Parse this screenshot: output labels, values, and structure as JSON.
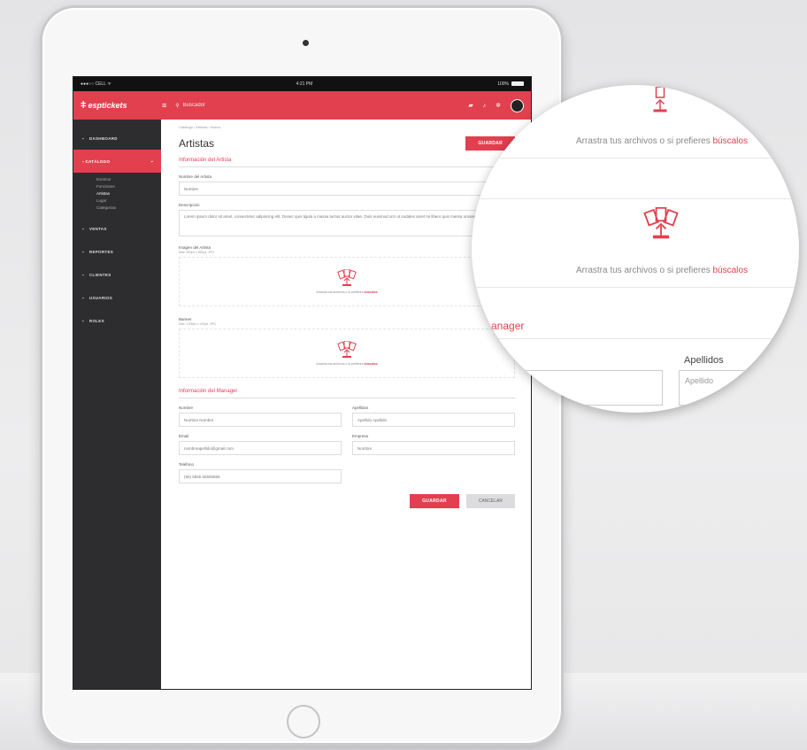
{
  "status_bar": {
    "carrier": "●●●○○ CELL ᯤ",
    "time": "4:21 PM",
    "battery": "100%"
  },
  "topbar": {
    "logo": "esptickets",
    "search_placeholder": "Buscador"
  },
  "sidebar": {
    "items": [
      {
        "label": "DASHBOARD"
      },
      {
        "label": "CATÁLOGO"
      },
      {
        "label": "VENTAS"
      },
      {
        "label": "REPORTES"
      },
      {
        "label": "CLIENTES"
      },
      {
        "label": "USUARIOS"
      },
      {
        "label": "ROLES"
      }
    ],
    "subitems": [
      "Eventos",
      "Funciones",
      "Artistas",
      "Lugar",
      "Categorías"
    ]
  },
  "main": {
    "breadcrumb": "Catálogo  /  Artistas  /  Nuevo",
    "title": "Artistas",
    "save_label": "GUARDAR",
    "section_artist": "Información del Artista",
    "name_label": "Nombre del Artista",
    "name_value": "Nombre",
    "desc_label": "Descripción",
    "desc_value": "Lorem ipsum dolor sit amet, consectetur adipiscing elit. Donec quis ligula a massa luctus auctor vitae. Duis euismod orci ut sodales amet mi libero quis massa ornare euismod.",
    "photo_label": "Imagen del Artista",
    "photo_sub": "Máx. 500px x 500px .JPG",
    "drop_text": "Arrastra tus archivos o si prefieres",
    "drop_link": "búscalos",
    "banner_label": "Banner",
    "banner_sub": "Máx. 1200px x 400px .JPG",
    "section_manager": "Información del Manager",
    "fields": [
      {
        "label": "Nombre",
        "value": "Nombre Nombre"
      },
      {
        "label": "Apellidos",
        "value": "Apellido Apellido"
      },
      {
        "label": "Email",
        "value": "nombreapellido@gmail.com"
      },
      {
        "label": "Empresa",
        "value": "Nombre"
      },
      {
        "label": "Teléfono",
        "value": "(55) 5555 55555555"
      }
    ],
    "cancel_label": "CANCELAR"
  },
  "magnifier": {
    "drop_text": "Arrastra tus archivos o si prefieres",
    "drop_link": "búscalos",
    "section_fragment": "anager",
    "apellidos_label": "Apellidos",
    "apellidos_value": "Apellido"
  },
  "colors": {
    "accent": "#e2404f",
    "sidebar": "#2d2d2f"
  }
}
